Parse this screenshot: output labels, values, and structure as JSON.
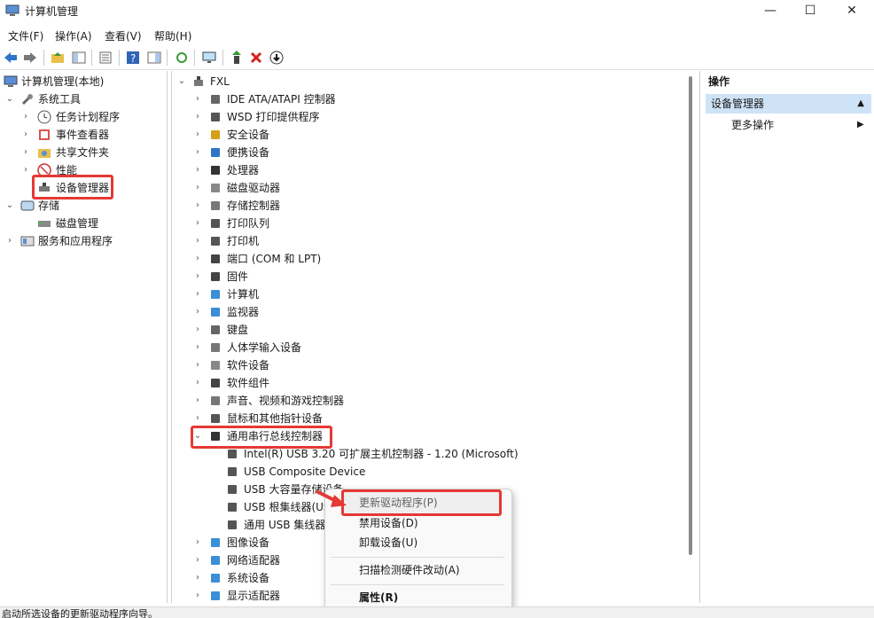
{
  "window": {
    "title": "计算机管理",
    "minimize": "—",
    "maximize": "☐",
    "close": "✕"
  },
  "menu": [
    "文件(F)",
    "操作(A)",
    "查看(V)",
    "帮助(H)"
  ],
  "left_tree": {
    "root": "计算机管理(本地)",
    "system_tools": "系统工具",
    "task_scheduler": "任务计划程序",
    "event_viewer": "事件查看器",
    "shared_folders": "共享文件夹",
    "performance": "性能",
    "device_manager": "设备管理器",
    "storage": "存储",
    "disk_management": "磁盘管理",
    "services_apps": "服务和应用程序"
  },
  "device_tree": {
    "root": "FXL",
    "categories": [
      "IDE ATA/ATAPI 控制器",
      "WSD 打印提供程序",
      "安全设备",
      "便携设备",
      "处理器",
      "磁盘驱动器",
      "存储控制器",
      "打印队列",
      "打印机",
      "端口 (COM 和 LPT)",
      "固件",
      "计算机",
      "监视器",
      "键盘",
      "人体学输入设备",
      "软件设备",
      "软件组件",
      "声音、视频和游戏控制器",
      "鼠标和其他指针设备",
      "通用串行总线控制器"
    ],
    "usb_children": [
      "Intel(R) USB 3.20 可扩展主机控制器 - 1.20 (Microsoft)",
      "USB Composite Device",
      "USB 大容量存储设备",
      "USB 根集线器(US",
      "通用 USB 集线器"
    ],
    "after_categories": [
      "图像设备",
      "网络适配器",
      "系统设备",
      "显示适配器"
    ]
  },
  "actions": {
    "header": "操作",
    "section": "设备管理器",
    "more": "更多操作"
  },
  "context_menu": {
    "update_driver": "更新驱动程序(P)",
    "disable": "禁用设备(D)",
    "uninstall": "卸载设备(U)",
    "scan": "扫描检测硬件改动(A)",
    "properties": "属性(R)"
  },
  "status": "启动所选设备的更新驱动程序向导。",
  "colors": {
    "highlight_red": "#e53935",
    "selection_blue": "#cfe3f7"
  }
}
